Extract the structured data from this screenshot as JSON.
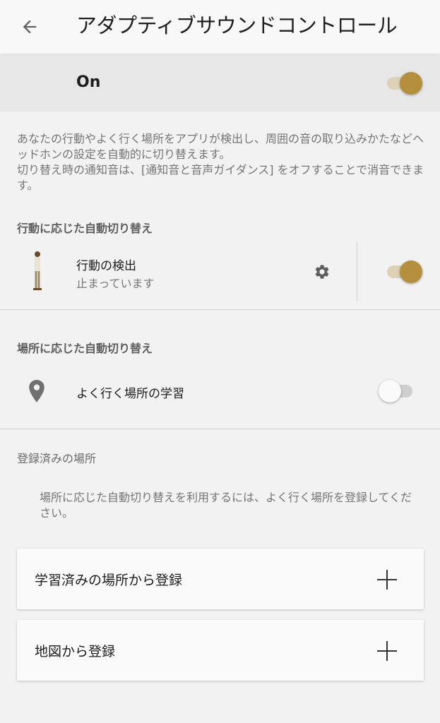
{
  "appbar": {
    "title": "アダプティブサウンドコントロール",
    "back_icon": "arrow-left-icon"
  },
  "master": {
    "label": "On",
    "enabled": true
  },
  "description": "あなたの行動やよく行く場所をアプリが検出し、周囲の音の取り込みかたなどヘッドホンの設定を自動的に切り替えます。\n切り替え時の通知音は、[通知音と音声ガイダンス] をオフすることで消音できます。",
  "activity_section": {
    "header": "行動に応じた自動切り替え",
    "item": {
      "title": "行動の検出",
      "status": "止まっています",
      "icon": "standing-person-icon",
      "settings_icon": "gear-icon",
      "enabled": true
    }
  },
  "place_section": {
    "header": "場所に応じた自動切り替え",
    "item": {
      "title": "よく行く場所の学習",
      "icon": "location-pin-icon",
      "enabled": false
    }
  },
  "registered": {
    "header": "登録済みの場所",
    "note": "場所に応じた自動切り替えを利用するには、よく行く場所を登録してください。",
    "cards": [
      {
        "label": "学習済みの場所から登録",
        "icon": "plus-icon"
      },
      {
        "label": "地図から登録",
        "icon": "plus-icon"
      }
    ]
  },
  "colors": {
    "accent": "#b58e3e",
    "accent_track": "#ddd2b5",
    "background": "#f2f2f2"
  }
}
